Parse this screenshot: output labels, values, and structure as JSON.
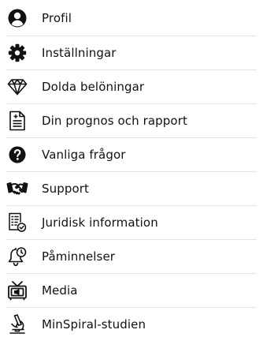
{
  "menu": {
    "items": [
      {
        "id": "profil",
        "label": "Profil",
        "icon": "user-circle-icon"
      },
      {
        "id": "installningar",
        "label": "Inställningar",
        "icon": "gear-icon"
      },
      {
        "id": "dolda-beloningar",
        "label": "Dolda belöningar",
        "icon": "diamond-icon"
      },
      {
        "id": "prognos",
        "label": "Din prognos och rapport",
        "icon": "document-icon"
      },
      {
        "id": "vanliga-fragor",
        "label": "Vanliga frågor",
        "icon": "question-icon"
      },
      {
        "id": "support",
        "label": "Support",
        "icon": "handshake-icon"
      },
      {
        "id": "juridisk",
        "label": "Juridisk information",
        "icon": "legal-document-icon"
      },
      {
        "id": "paminnelser",
        "label": "Påminnelser",
        "icon": "bell-clock-icon"
      },
      {
        "id": "media",
        "label": "Media",
        "icon": "tv-icon"
      },
      {
        "id": "minspiral",
        "label": "MinSpiral-studien",
        "icon": "microscope-icon"
      }
    ]
  }
}
